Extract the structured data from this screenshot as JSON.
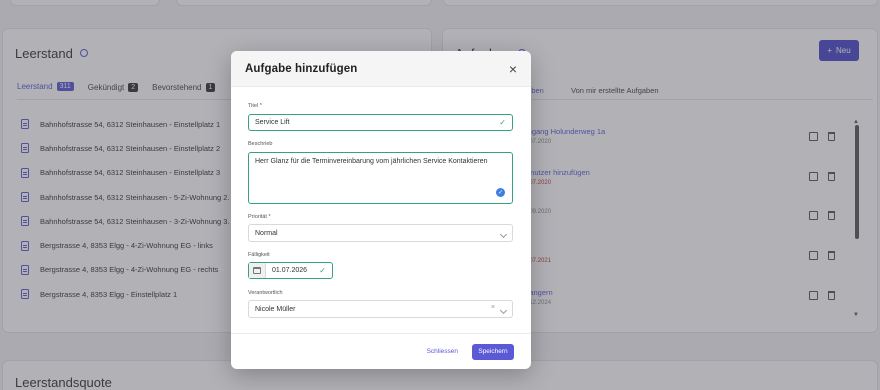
{
  "left_card": {
    "title": "Leerstand",
    "tabs": [
      {
        "label": "Leerstand",
        "count": "311"
      },
      {
        "label": "Gekündigt",
        "count": "2"
      },
      {
        "label": "Bevorstehend",
        "count": "1"
      }
    ],
    "items": [
      "Bahnhofstrasse 54, 6312 Steinhausen - Einstellplatz 1",
      "Bahnhofstrasse 54, 6312 Steinhausen - Einstellplatz 2",
      "Bahnhofstrasse 54, 6312 Steinhausen - Einstellplatz 3",
      "Bahnhofstrasse 54, 6312 Steinhausen - 5-Zi-Wohnung 2. O",
      "Bahnhofstrasse 54, 6312 Steinhausen - 3-Zi-Wohnung 3. O",
      "Bergstrasse 4, 8353 Elgg - 4-Zi-Wohnung EG - links",
      "Bergstrasse 4, 8353 Elgg - 4-Zi-Wohnung EG - rechts",
      "Bergstrasse 4, 8353 Elgg - Einstellplatz 1"
    ]
  },
  "right_card": {
    "title": "Aufgaben",
    "new_button": "Neu",
    "tabs": [
      "gaben",
      "Von mir erstellte Aufgaben"
    ],
    "tasks": [
      {
        "title": "Eingang Holunderweg 1a",
        "date": "15.07.2020"
      },
      {
        "title": "Benutzer hinzufügen",
        "date": "10.07.2020"
      },
      {
        "title": "",
        "date": "29.09.2020"
      },
      {
        "title": "e",
        "date": "20.07.2021"
      },
      {
        "title": "erlangern",
        "date": "05.12.2024"
      }
    ]
  },
  "bottom_card": {
    "title": "Leerstandsquote"
  },
  "modal": {
    "title": "Aufgabe hinzufügen",
    "close_icon": "×",
    "titel_label": "Titel *",
    "titel_value": "Service Lift",
    "beschrieb_label": "Beschrieb",
    "beschrieb_value": "Herr Glanz für die Terminvereinbarung vom jährlichen Service Kontaktieren",
    "prioritat_label": "Priorität *",
    "prioritat_value": "Normal",
    "falligkeit_label": "Fälligkeit",
    "falligkeit_value": "01.07.2026",
    "verantwortlich_label": "Verantwortlich",
    "verantwortlich_value": "Nicole Müller",
    "cancel_label": "Schliessen",
    "save_label": "Speichern"
  },
  "colors": {
    "accent": "#5b59d6",
    "valid": "#36a27b",
    "overlay": "rgba(70,70,80,0.42)"
  }
}
